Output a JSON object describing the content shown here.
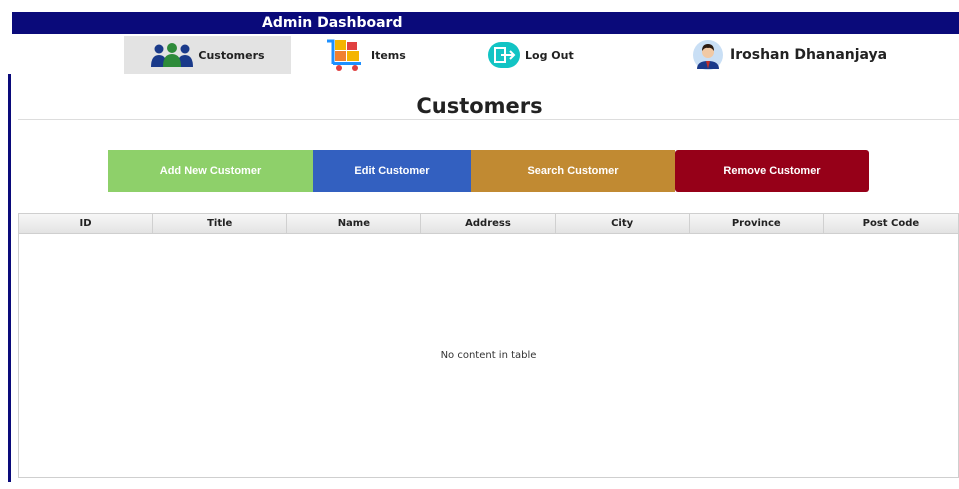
{
  "window": {
    "title": "Admin Dashboard"
  },
  "nav": {
    "customers_label": "Customers",
    "items_label": "Items",
    "logout_label": "Log Out",
    "user_name": "Iroshan Dhananjaya"
  },
  "page": {
    "title": "Customers"
  },
  "actions": {
    "add": "Add New Customer",
    "edit": "Edit Customer",
    "search": "Search Customer",
    "remove": "Remove Customer"
  },
  "table": {
    "columns": [
      "ID",
      "Title",
      "Name",
      "Address",
      "City",
      "Province",
      "Post Code"
    ],
    "rows": [],
    "empty_message": "No content in table"
  },
  "colors": {
    "titlebar": "#0a0a7a",
    "add": "#8ed06a",
    "edit": "#3360c0",
    "search": "#c18a32",
    "remove": "#960018"
  },
  "icons": {
    "customers": "users-icon",
    "items": "boxes-cart-icon",
    "logout": "logout-icon",
    "user": "avatar-icon"
  }
}
